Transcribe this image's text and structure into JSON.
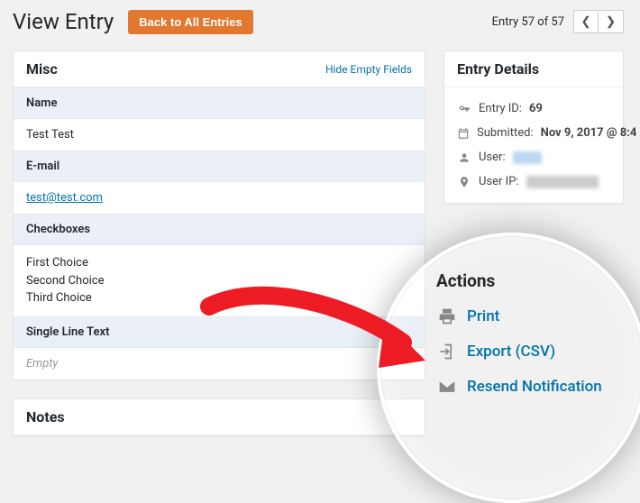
{
  "header": {
    "title": "View Entry",
    "back_button": "Back to All Entries",
    "pagination_text": "Entry 57 of 57"
  },
  "main_panel": {
    "title": "Misc",
    "hide_link": "Hide Empty Fields",
    "fields": {
      "name_label": "Name",
      "name_value": "Test Test",
      "email_label": "E-mail",
      "email_value": "test@test.com",
      "checkboxes_label": "Checkboxes",
      "checkboxes_values": [
        "First Choice",
        "Second Choice",
        "Third Choice"
      ],
      "single_line_label": "Single Line Text",
      "single_line_value": "Empty"
    }
  },
  "notes_panel": {
    "title": "Notes"
  },
  "details_panel": {
    "title": "Entry Details",
    "entry_id_label": "Entry ID:",
    "entry_id_value": "69",
    "submitted_label": "Submitted:",
    "submitted_value": "Nov 9, 2017 @ 8:4",
    "user_label": "User:",
    "user_ip_label": "User IP:"
  },
  "actions": {
    "title": "Actions",
    "print": "Print",
    "export": "Export (CSV)",
    "resend": "Resend Notification"
  }
}
